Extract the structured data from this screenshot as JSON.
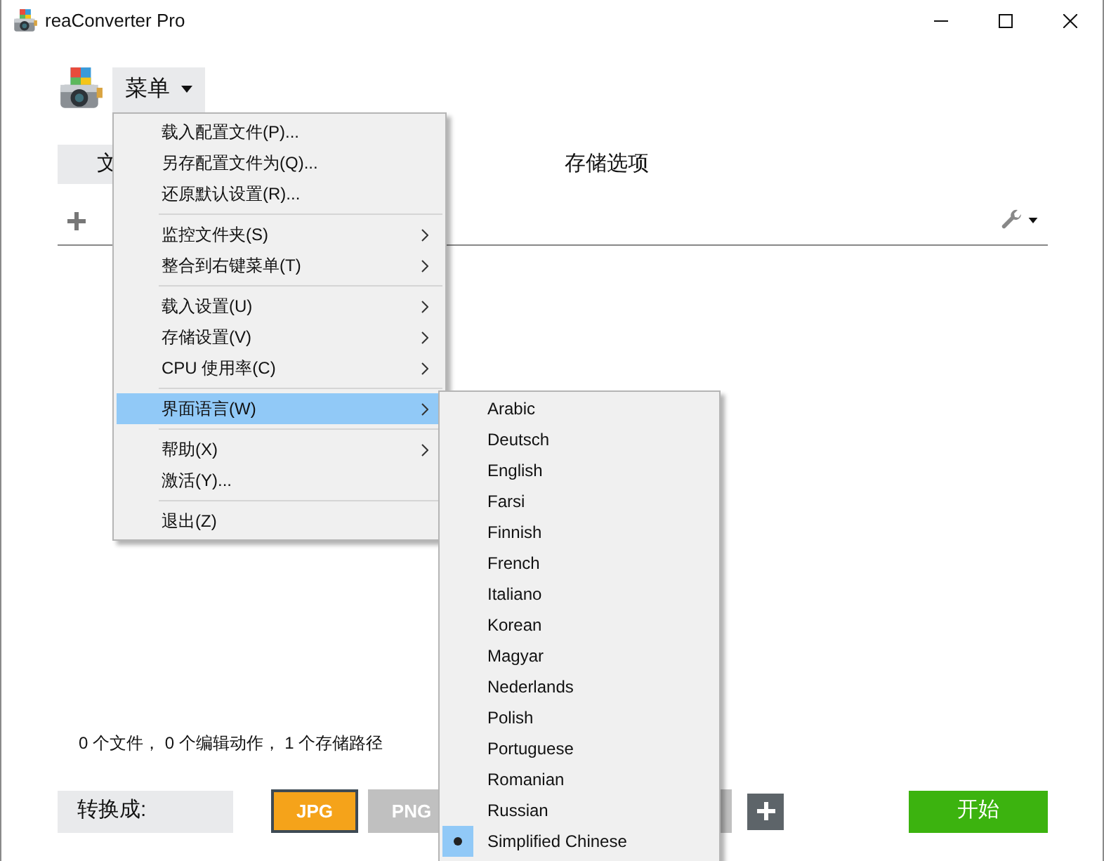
{
  "window": {
    "title": "reaConverter Pro"
  },
  "menu_button": {
    "label": "菜单"
  },
  "tabs": [
    {
      "label": "文",
      "selected": false
    },
    {
      "label": "存储选项",
      "selected": true
    }
  ],
  "status_text": "0 个文件， 0 个编辑动作， 1 个存储路径",
  "convert_label": "转换成:",
  "formats": [
    {
      "label": "JPG",
      "selected": true
    },
    {
      "label": "PNG",
      "selected": false
    },
    {
      "selected": false
    }
  ],
  "start_button": "开始",
  "menu": [
    {
      "kind": "item",
      "label": "载入配置文件(P)...",
      "submenu": false,
      "selected": false
    },
    {
      "kind": "item",
      "label": "另存配置文件为(Q)...",
      "submenu": false,
      "selected": false
    },
    {
      "kind": "item",
      "label": "还原默认设置(R)...",
      "submenu": false,
      "selected": false
    },
    {
      "kind": "separator"
    },
    {
      "kind": "item",
      "label": "监控文件夹(S)",
      "submenu": true,
      "selected": false
    },
    {
      "kind": "item",
      "label": "整合到右键菜单(T)",
      "submenu": true,
      "selected": false
    },
    {
      "kind": "separator"
    },
    {
      "kind": "item",
      "label": "载入设置(U)",
      "submenu": true,
      "selected": false
    },
    {
      "kind": "item",
      "label": "存储设置(V)",
      "submenu": true,
      "selected": false
    },
    {
      "kind": "item",
      "label": "CPU 使用率(C)",
      "submenu": true,
      "selected": false
    },
    {
      "kind": "separator"
    },
    {
      "kind": "item",
      "label": "界面语言(W)",
      "submenu": true,
      "selected": true
    },
    {
      "kind": "separator"
    },
    {
      "kind": "item",
      "label": "帮助(X)",
      "submenu": true,
      "selected": false
    },
    {
      "kind": "item",
      "label": "激活(Y)...",
      "submenu": false,
      "selected": false
    },
    {
      "kind": "separator"
    },
    {
      "kind": "item",
      "label": "退出(Z)",
      "submenu": false,
      "selected": false
    }
  ],
  "languages": [
    {
      "label": "Arabic",
      "selected": false
    },
    {
      "label": "Deutsch",
      "selected": false
    },
    {
      "label": "English",
      "selected": false
    },
    {
      "label": "Farsi",
      "selected": false
    },
    {
      "label": "Finnish",
      "selected": false
    },
    {
      "label": "French",
      "selected": false
    },
    {
      "label": "Italiano",
      "selected": false
    },
    {
      "label": "Korean",
      "selected": false
    },
    {
      "label": "Magyar",
      "selected": false
    },
    {
      "label": "Nederlands",
      "selected": false
    },
    {
      "label": "Polish",
      "selected": false
    },
    {
      "label": "Portuguese",
      "selected": false
    },
    {
      "label": "Romanian",
      "selected": false
    },
    {
      "label": "Russian",
      "selected": false
    },
    {
      "label": "Simplified Chinese",
      "selected": true
    }
  ]
}
